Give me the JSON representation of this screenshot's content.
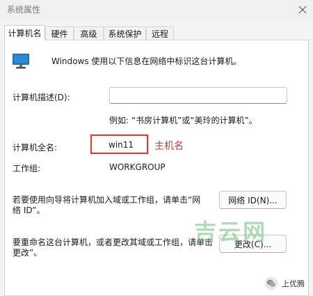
{
  "window": {
    "title": "系统属性"
  },
  "tabs": [
    {
      "label": "计算机名"
    },
    {
      "label": "硬件"
    },
    {
      "label": "高级"
    },
    {
      "label": "系统保护"
    },
    {
      "label": "远程"
    }
  ],
  "content": {
    "intro_text": "Windows 使用以下信息在网络中标识这台计算机。",
    "description_label": "计算机描述(D):",
    "description_value": "",
    "description_example": "例如: “书房计算机”或“美玲的计算机”。",
    "fullname_label": "计算机全名:",
    "fullname_value": "win11",
    "fullname_annotation": "主机名",
    "workgroup_label": "工作组:",
    "workgroup_value": "WORKGROUP",
    "network_text_line1": "若要使用向导将计算机加入域或工作组，请单击“网",
    "network_text_line2": "络 ID”。",
    "network_button": "网络 ID(N)...",
    "rename_text_line1": "要重命名这台计算机，或者更改其域或工作组，请单击",
    "rename_text_line2": "更改”。",
    "change_button": "更改(C)..."
  },
  "watermark": {
    "text": "吉云网"
  },
  "wechat": {
    "name": "上优腾"
  },
  "colors": {
    "annotation": "#e0362b",
    "watermark": "#6ebe7d"
  },
  "icons": {
    "monitor": "monitor-icon",
    "close": "close-icon",
    "wechat": "wechat-icon"
  }
}
